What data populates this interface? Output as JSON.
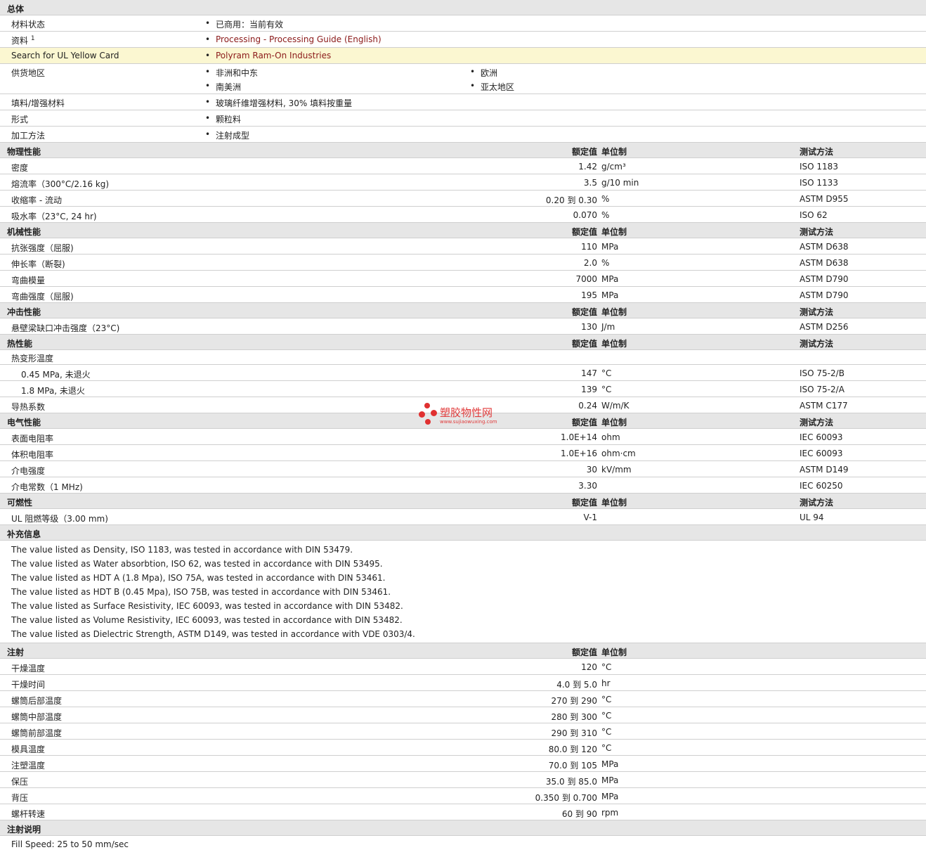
{
  "general": {
    "header": "总体",
    "status_label": "材料状态",
    "status_value": "已商用：当前有效",
    "docs_label": "资料",
    "docs_sup": "1",
    "docs_value": "Processing - Processing Guide (English)",
    "ul_label": "Search for UL Yellow Card",
    "ul_value": "Polyram Ram-On Industries",
    "regions_label": "供货地区",
    "regions": [
      "非洲和中东",
      "南美洲",
      "欧洲",
      "亚太地区"
    ],
    "filler_label": "填料/增强材料",
    "filler_value": "玻璃纤维增强材料, 30% 填料按重量",
    "form_label": "形式",
    "form_value": "颗粒料",
    "process_label": "加工方法",
    "process_value": "注射成型"
  },
  "col_headers": {
    "nominal": "额定值",
    "unit": "单位制",
    "test": "测试方法"
  },
  "physical": {
    "title": "物理性能",
    "rows": [
      {
        "label": "密度",
        "value": "1.42",
        "unit": "g/cm³",
        "test": "ISO 1183"
      },
      {
        "label": "熔流率（300°C/2.16 kg)",
        "value": "3.5",
        "unit": "g/10 min",
        "test": "ISO 1133"
      },
      {
        "label": "收缩率 - 流动",
        "value": "0.20 到  0.30",
        "unit": "%",
        "test": "ASTM D955"
      },
      {
        "label": "吸水率（23°C, 24 hr)",
        "value": "0.070",
        "unit": "%",
        "test": "ISO 62"
      }
    ]
  },
  "mechanical": {
    "title": "机械性能",
    "rows": [
      {
        "label": "抗张强度（屈服)",
        "value": "110",
        "unit": "MPa",
        "test": "ASTM D638"
      },
      {
        "label": "伸长率（断裂)",
        "value": "2.0",
        "unit": "%",
        "test": "ASTM D638"
      },
      {
        "label": "弯曲模量",
        "value": "7000",
        "unit": "MPa",
        "test": "ASTM D790"
      },
      {
        "label": "弯曲强度（屈服)",
        "value": "195",
        "unit": "MPa",
        "test": "ASTM D790"
      }
    ]
  },
  "impact": {
    "title": "冲击性能",
    "rows": [
      {
        "label": "悬壁梁缺口冲击强度（23°C)",
        "value": "130",
        "unit": "J/m",
        "test": "ASTM D256"
      }
    ]
  },
  "thermal": {
    "title": "热性能",
    "hdt_label": "热变形温度",
    "rows": [
      {
        "label": "0.45 MPa, 未退火",
        "value": "147",
        "unit": "°C",
        "test": "ISO 75-2/B"
      },
      {
        "label": "1.8 MPa, 未退火",
        "value": "139",
        "unit": "°C",
        "test": "ISO 75-2/A"
      }
    ],
    "cond": {
      "label": "导热系数",
      "value": "0.24",
      "unit": "W/m/K",
      "test": "ASTM C177"
    }
  },
  "electrical": {
    "title": "电气性能",
    "rows": [
      {
        "label": "表面电阻率",
        "value": "1.0E+14",
        "unit": "ohm",
        "test": "IEC 60093"
      },
      {
        "label": "体积电阻率",
        "value": "1.0E+16",
        "unit": "ohm·cm",
        "test": "IEC 60093"
      },
      {
        "label": "介电强度",
        "value": "30",
        "unit": "kV/mm",
        "test": "ASTM D149"
      },
      {
        "label": "介电常数（1 MHz)",
        "value": "3.30",
        "unit": "",
        "test": "IEC 60250"
      }
    ]
  },
  "flammability": {
    "title": "可燃性",
    "rows": [
      {
        "label": "UL 阻燃等级（3.00 mm)",
        "value": "V-1",
        "unit": "",
        "test": "UL 94"
      }
    ]
  },
  "supplemental": {
    "title": "补充信息",
    "notes": [
      "The value listed as Density, ISO 1183, was tested in accordance with DIN 53479.",
      "The value listed as Water absorbtion, ISO 62, was tested in accordance with DIN 53495.",
      "The value listed as HDT A (1.8 Mpa), ISO 75A, was tested in accordance with DIN 53461.",
      "The value listed as HDT B (0.45 Mpa), ISO 75B, was tested in accordance with DIN 53461.",
      "The value listed as Surface Resistivity, IEC 60093, was tested in accordance with DIN 53482.",
      "The value listed as Volume Resistivity, IEC 60093, was tested in accordance with DIN 53482.",
      "The value listed as Dielectric Strength, ASTM D149, was tested in accordance with VDE 0303/4."
    ]
  },
  "injection": {
    "title": "注射",
    "rows": [
      {
        "label": "干燥温度",
        "value": "120",
        "unit": "°C",
        "test": ""
      },
      {
        "label": "干燥时间",
        "value": "4.0 到  5.0",
        "unit": "hr",
        "test": ""
      },
      {
        "label": "螺筒后部温度",
        "value": "270 到  290",
        "unit": "°C",
        "test": ""
      },
      {
        "label": "螺筒中部温度",
        "value": "280 到  300",
        "unit": "°C",
        "test": ""
      },
      {
        "label": "螺筒前部温度",
        "value": "290 到  310",
        "unit": "°C",
        "test": ""
      },
      {
        "label": "模具温度",
        "value": "80.0 到  120",
        "unit": "°C",
        "test": ""
      },
      {
        "label": "注塑温度",
        "value": "70.0 到  105",
        "unit": "MPa",
        "test": ""
      },
      {
        "label": "保压",
        "value": "35.0 到  85.0",
        "unit": "MPa",
        "test": ""
      },
      {
        "label": "背压",
        "value": "0.350 到  0.700",
        "unit": "MPa",
        "test": ""
      },
      {
        "label": "螺杆转速",
        "value": "60 到  90",
        "unit": "rpm",
        "test": ""
      }
    ]
  },
  "injection_notes": {
    "title": "注射说明",
    "text": "Fill Speed: 25 to 50 mm/sec"
  },
  "watermark": {
    "cn": "塑胶物性网",
    "url": "www.sujiaowuxing.com"
  },
  "colors": {
    "header_bg": "#e6e6e6",
    "highlight_bg": "#fbf7d1",
    "link": "#8b1a1a",
    "watermark": "#e03030"
  }
}
